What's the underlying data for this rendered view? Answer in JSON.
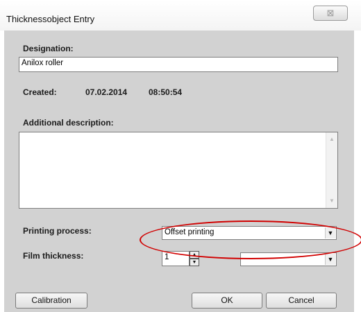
{
  "window": {
    "title": "Thicknessobject Entry",
    "close_glyph": "⊠"
  },
  "designation": {
    "label": "Designation:",
    "value": "Anilox roller"
  },
  "created": {
    "label": "Created:",
    "date": "07.02.2014",
    "time": "08:50:54"
  },
  "description": {
    "label": "Additional description:",
    "value": "",
    "scroll_up_icon": "▲",
    "scroll_down_icon": "▼"
  },
  "printing_process": {
    "label": "Printing process:",
    "selected": "Offset printing",
    "dropdown_icon": "▼"
  },
  "film_thickness": {
    "label": "Film thickness:",
    "value": "1",
    "spin_up_icon": "▲",
    "spin_down_icon": "▼",
    "unit_selected": "",
    "dropdown_icon": "▼"
  },
  "buttons": {
    "calibration": "Calibration",
    "ok": "OK",
    "cancel": "Cancel"
  },
  "colors": {
    "dialog_background": "#d2d2d2",
    "highlight": "#d10000"
  }
}
